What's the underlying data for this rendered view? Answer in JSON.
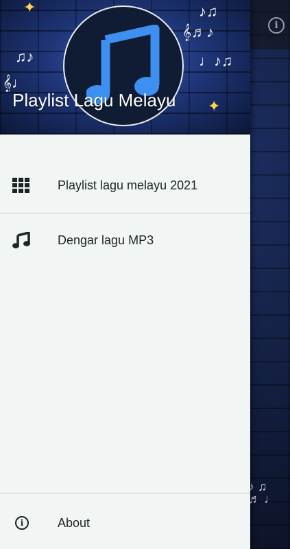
{
  "app": {
    "info_icon": "info-icon",
    "info_glyph": "i"
  },
  "drawer": {
    "header_title": "Playlist Lagu Melayu",
    "logo_icon": "music-note-icon",
    "items": [
      {
        "label": "Playlist lagu melayu 2021",
        "icon": "grid-icon"
      },
      {
        "label": "Dengar lagu MP3",
        "icon": "music-note-icon"
      }
    ],
    "footer": {
      "label": "About",
      "icon": "info-icon",
      "glyph": "i"
    }
  },
  "colors": {
    "drawer_bg": "#f1f5f4",
    "logo_note": "#3d8ff0",
    "text": "#1e2326"
  }
}
